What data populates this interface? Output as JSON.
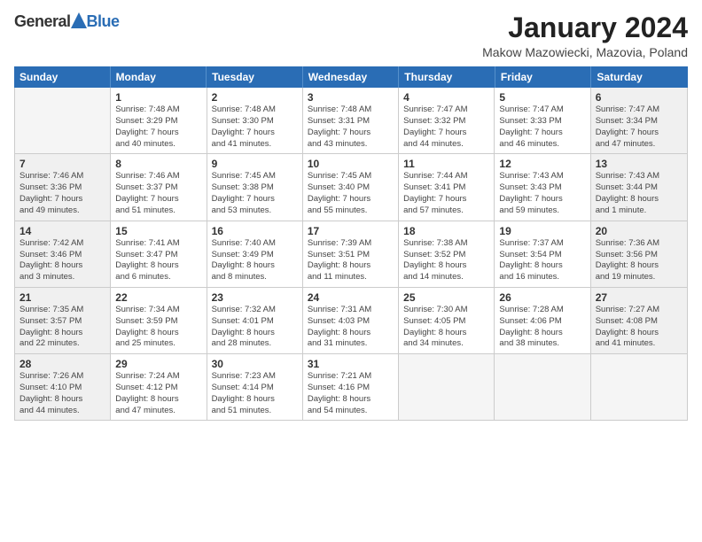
{
  "logo": {
    "general": "General",
    "blue": "Blue"
  },
  "title": "January 2024",
  "subtitle": "Makow Mazowiecki, Mazovia, Poland",
  "header_days": [
    "Sunday",
    "Monday",
    "Tuesday",
    "Wednesday",
    "Thursday",
    "Friday",
    "Saturday"
  ],
  "weeks": [
    [
      {
        "day": "",
        "info": "",
        "empty": true
      },
      {
        "day": "1",
        "info": "Sunrise: 7:48 AM\nSunset: 3:29 PM\nDaylight: 7 hours\nand 40 minutes."
      },
      {
        "day": "2",
        "info": "Sunrise: 7:48 AM\nSunset: 3:30 PM\nDaylight: 7 hours\nand 41 minutes."
      },
      {
        "day": "3",
        "info": "Sunrise: 7:48 AM\nSunset: 3:31 PM\nDaylight: 7 hours\nand 43 minutes."
      },
      {
        "day": "4",
        "info": "Sunrise: 7:47 AM\nSunset: 3:32 PM\nDaylight: 7 hours\nand 44 minutes."
      },
      {
        "day": "5",
        "info": "Sunrise: 7:47 AM\nSunset: 3:33 PM\nDaylight: 7 hours\nand 46 minutes."
      },
      {
        "day": "6",
        "info": "Sunrise: 7:47 AM\nSunset: 3:34 PM\nDaylight: 7 hours\nand 47 minutes."
      }
    ],
    [
      {
        "day": "7",
        "info": "Sunrise: 7:46 AM\nSunset: 3:36 PM\nDaylight: 7 hours\nand 49 minutes."
      },
      {
        "day": "8",
        "info": "Sunrise: 7:46 AM\nSunset: 3:37 PM\nDaylight: 7 hours\nand 51 minutes."
      },
      {
        "day": "9",
        "info": "Sunrise: 7:45 AM\nSunset: 3:38 PM\nDaylight: 7 hours\nand 53 minutes."
      },
      {
        "day": "10",
        "info": "Sunrise: 7:45 AM\nSunset: 3:40 PM\nDaylight: 7 hours\nand 55 minutes."
      },
      {
        "day": "11",
        "info": "Sunrise: 7:44 AM\nSunset: 3:41 PM\nDaylight: 7 hours\nand 57 minutes."
      },
      {
        "day": "12",
        "info": "Sunrise: 7:43 AM\nSunset: 3:43 PM\nDaylight: 7 hours\nand 59 minutes."
      },
      {
        "day": "13",
        "info": "Sunrise: 7:43 AM\nSunset: 3:44 PM\nDaylight: 8 hours\nand 1 minute."
      }
    ],
    [
      {
        "day": "14",
        "info": "Sunrise: 7:42 AM\nSunset: 3:46 PM\nDaylight: 8 hours\nand 3 minutes."
      },
      {
        "day": "15",
        "info": "Sunrise: 7:41 AM\nSunset: 3:47 PM\nDaylight: 8 hours\nand 6 minutes."
      },
      {
        "day": "16",
        "info": "Sunrise: 7:40 AM\nSunset: 3:49 PM\nDaylight: 8 hours\nand 8 minutes."
      },
      {
        "day": "17",
        "info": "Sunrise: 7:39 AM\nSunset: 3:51 PM\nDaylight: 8 hours\nand 11 minutes."
      },
      {
        "day": "18",
        "info": "Sunrise: 7:38 AM\nSunset: 3:52 PM\nDaylight: 8 hours\nand 14 minutes."
      },
      {
        "day": "19",
        "info": "Sunrise: 7:37 AM\nSunset: 3:54 PM\nDaylight: 8 hours\nand 16 minutes."
      },
      {
        "day": "20",
        "info": "Sunrise: 7:36 AM\nSunset: 3:56 PM\nDaylight: 8 hours\nand 19 minutes."
      }
    ],
    [
      {
        "day": "21",
        "info": "Sunrise: 7:35 AM\nSunset: 3:57 PM\nDaylight: 8 hours\nand 22 minutes."
      },
      {
        "day": "22",
        "info": "Sunrise: 7:34 AM\nSunset: 3:59 PM\nDaylight: 8 hours\nand 25 minutes."
      },
      {
        "day": "23",
        "info": "Sunrise: 7:32 AM\nSunset: 4:01 PM\nDaylight: 8 hours\nand 28 minutes."
      },
      {
        "day": "24",
        "info": "Sunrise: 7:31 AM\nSunset: 4:03 PM\nDaylight: 8 hours\nand 31 minutes."
      },
      {
        "day": "25",
        "info": "Sunrise: 7:30 AM\nSunset: 4:05 PM\nDaylight: 8 hours\nand 34 minutes."
      },
      {
        "day": "26",
        "info": "Sunrise: 7:28 AM\nSunset: 4:06 PM\nDaylight: 8 hours\nand 38 minutes."
      },
      {
        "day": "27",
        "info": "Sunrise: 7:27 AM\nSunset: 4:08 PM\nDaylight: 8 hours\nand 41 minutes."
      }
    ],
    [
      {
        "day": "28",
        "info": "Sunrise: 7:26 AM\nSunset: 4:10 PM\nDaylight: 8 hours\nand 44 minutes."
      },
      {
        "day": "29",
        "info": "Sunrise: 7:24 AM\nSunset: 4:12 PM\nDaylight: 8 hours\nand 47 minutes."
      },
      {
        "day": "30",
        "info": "Sunrise: 7:23 AM\nSunset: 4:14 PM\nDaylight: 8 hours\nand 51 minutes."
      },
      {
        "day": "31",
        "info": "Sunrise: 7:21 AM\nSunset: 4:16 PM\nDaylight: 8 hours\nand 54 minutes."
      },
      {
        "day": "",
        "info": "",
        "empty": true
      },
      {
        "day": "",
        "info": "",
        "empty": true
      },
      {
        "day": "",
        "info": "",
        "empty": true
      }
    ]
  ]
}
